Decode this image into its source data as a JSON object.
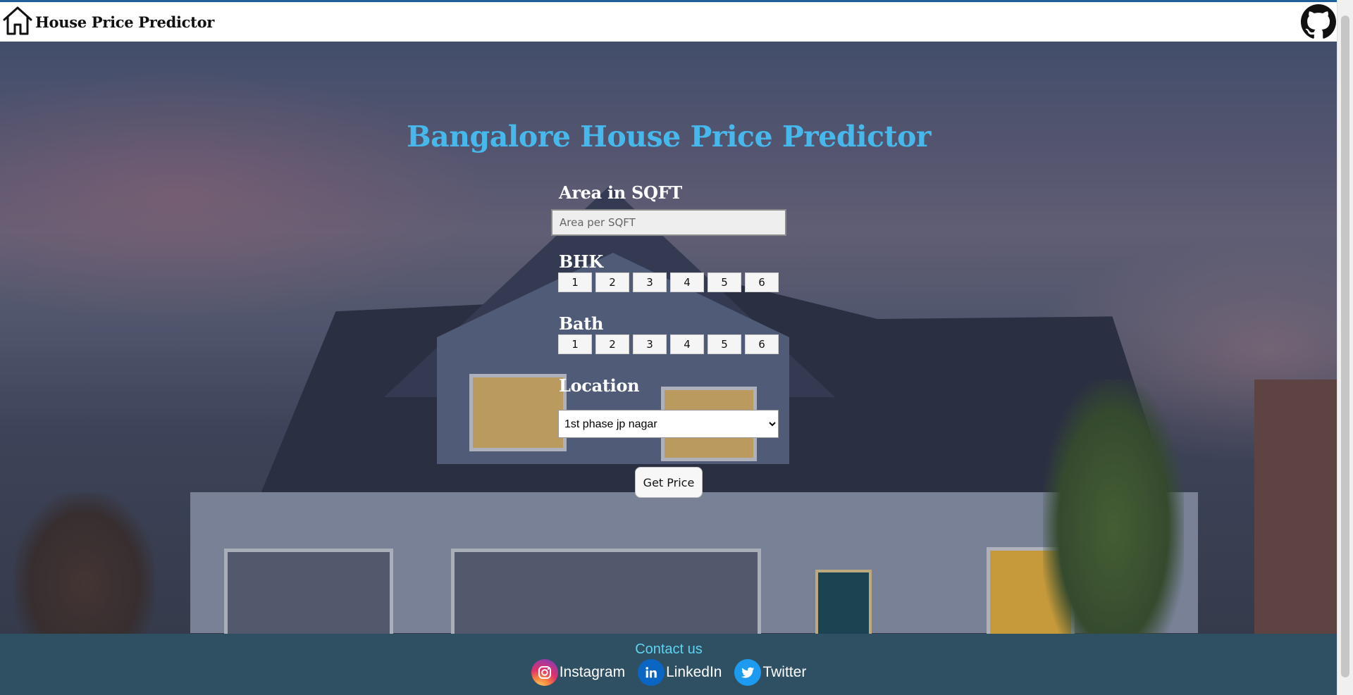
{
  "navbar": {
    "brand_title": "House Price Predictor",
    "home_icon": "house-outline-icon",
    "github_icon": "github-icon"
  },
  "form": {
    "title": "Bangalore House Price Predictor",
    "area_label": "Area in SQFT",
    "area_placeholder": "Area per SQFT",
    "bhk_label": "BHK",
    "bhk_options": [
      "1",
      "2",
      "3",
      "4",
      "5",
      "6"
    ],
    "bath_label": "Bath",
    "bath_options": [
      "1",
      "2",
      "3",
      "4",
      "5",
      "6"
    ],
    "location_label": "Location",
    "location_selected": "1st phase jp nagar",
    "submit_label": "Get Price"
  },
  "footer": {
    "contact_label": "Contact us",
    "socials": [
      {
        "label": "Instagram",
        "icon": "instagram-icon",
        "color": "#e1306c"
      },
      {
        "label": "LinkedIn",
        "icon": "linkedin-icon",
        "color": "#0a66c2"
      },
      {
        "label": "Twitter",
        "icon": "twitter-icon",
        "color": "#1d9bf0"
      }
    ]
  },
  "colors": {
    "title": "#47b8ec",
    "contact": "#5fd4f0",
    "footer_bg": "#2f4f63",
    "navbar_bg": "#ffffff"
  }
}
